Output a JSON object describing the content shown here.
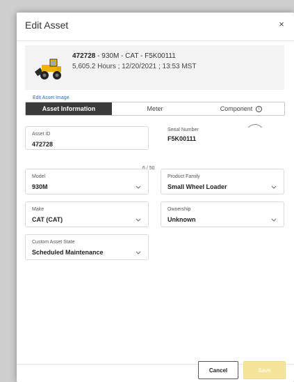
{
  "dialog": {
    "title": "Edit Asset",
    "close_label": "×"
  },
  "asset": {
    "id_bold": "472728",
    "summary_rest": " - 930M - CAT - F5K00111",
    "meter_line": "5,605.2 Hours ; 12/20/2021 ; 13:53 MST",
    "image_icon": "wheel-loader-image",
    "edit_image_link": "Edit Asset Image"
  },
  "tabs": [
    {
      "label": "Asset Information",
      "active": true
    },
    {
      "label": "Meter",
      "active": false
    },
    {
      "label": "Component",
      "active": false
    }
  ],
  "info_icon_glyph": "i",
  "fields": {
    "asset_id": {
      "label": "Asset ID",
      "value": "472728",
      "counter": "6 / 50"
    },
    "serial_number": {
      "label": "Serial Number",
      "value": "F5K00111"
    },
    "model": {
      "label": "Model",
      "value": "930M"
    },
    "product_family": {
      "label": "Product Family",
      "value": "Small Wheel Loader"
    },
    "make": {
      "label": "Make",
      "value": "CAT (CAT)"
    },
    "ownership": {
      "label": "Ownership",
      "value": "Unknown"
    },
    "custom_asset_state": {
      "label": "Custom Asset State",
      "value": "Scheduled Maintenance"
    }
  },
  "footer": {
    "cancel_label": "Cancel",
    "save_label": "Save"
  },
  "colors": {
    "active_tab": "#3a3a3a",
    "link": "#2a6fb8",
    "save_disabled": "#f6e49a"
  }
}
